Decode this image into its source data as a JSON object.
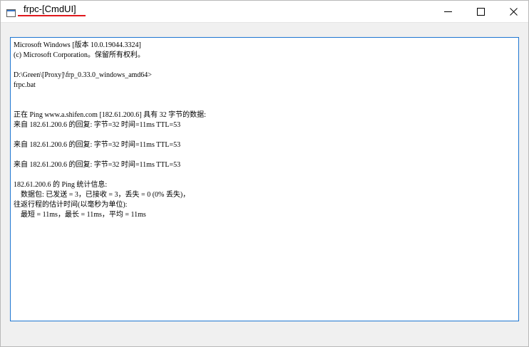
{
  "window": {
    "title": "frpc-[CmdUI]",
    "title_underline_color": "#e0181c",
    "controls": {
      "minimize_icon": "minimize-icon",
      "maximize_icon": "maximize-icon",
      "close_icon": "close-icon"
    }
  },
  "console": {
    "border_color": "#1e76d1",
    "lines": [
      "Microsoft Windows [版本 10.0.19044.3324]",
      "(c) Microsoft Corporation。保留所有权利。",
      "",
      "D:\\Green\\[Proxy]\\frp_0.33.0_windows_amd64>",
      "frpc.bat",
      "",
      "",
      "正在 Ping www.a.shifen.com [182.61.200.6] 具有 32 字节的数据:",
      "来自 182.61.200.6 的回复: 字节=32 时间=11ms TTL=53",
      "",
      "来自 182.61.200.6 的回复: 字节=32 时间=11ms TTL=53",
      "",
      "来自 182.61.200.6 的回复: 字节=32 时间=11ms TTL=53",
      "",
      "182.61.200.6 的 Ping 统计信息:",
      "    数据包: 已发送 = 3，已接收 = 3，丢失 = 0 (0% 丢失)，",
      "往返行程的估计时间(以毫秒为单位):",
      "    最短 = 11ms，最长 = 11ms，平均 = 11ms"
    ]
  }
}
